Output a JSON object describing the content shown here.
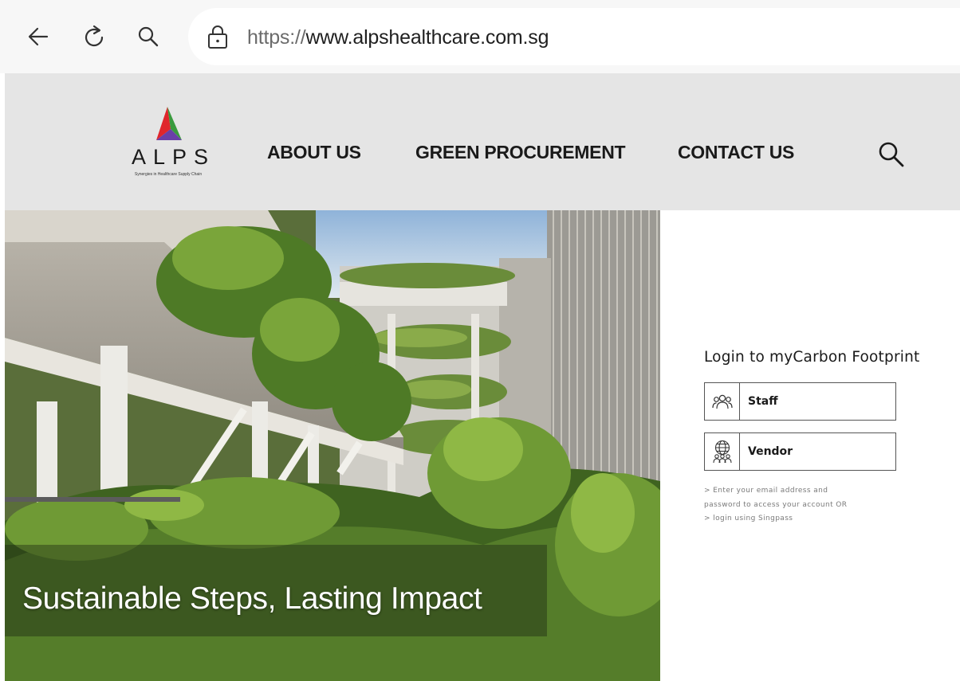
{
  "browser": {
    "url_scheme": "https://",
    "url_host": "www.alpshealthcare.com.sg",
    "icons": [
      "back-arrow-icon",
      "reload-icon",
      "search-icon",
      "lock-icon"
    ]
  },
  "header": {
    "logo_text": "ALPS",
    "logo_tagline": "Synergies in Healthcare Supply Chain",
    "menu": {
      "about": "ABOUT US",
      "green": "GREEN PROCUREMENT",
      "contact": "CONTACT US"
    },
    "search_icon": "search-icon",
    "logo_colors": [
      "#e0262c",
      "#3a9a3e",
      "#6a3fa8"
    ]
  },
  "hero": {
    "title": "Sustainable Steps, Lasting Impact"
  },
  "login": {
    "title": "Login to myCarbon Footprint",
    "staff_label": "Staff",
    "vendor_label": "Vendor",
    "staff_icon": "people-group-icon",
    "vendor_icon": "globe-people-icon",
    "help_lines": [
      "> Enter your email address and",
      "password to access your account OR",
      "> login using Singpass"
    ]
  }
}
